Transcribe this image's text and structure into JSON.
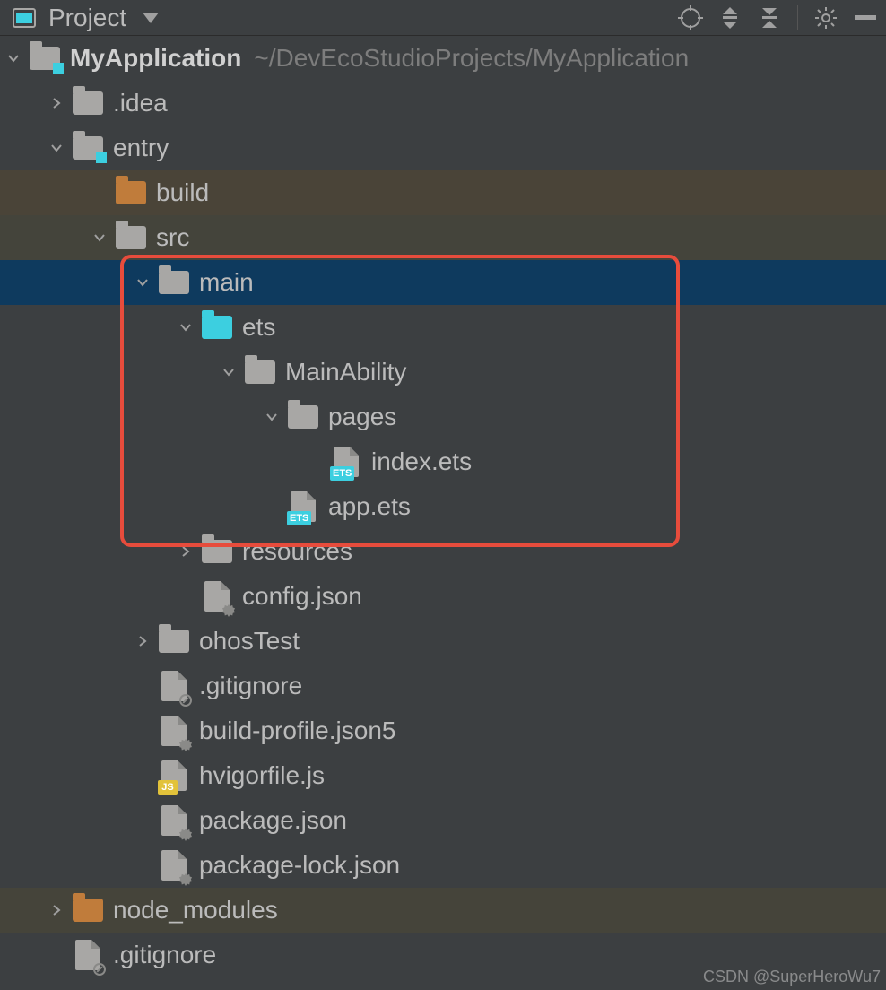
{
  "toolbar": {
    "view_label": "Project"
  },
  "root": {
    "name": "MyApplication",
    "path_hint": "~/DevEcoStudioProjects/MyApplication"
  },
  "nodes": [
    {
      "id": "idea",
      "label": ".idea",
      "indent": 1,
      "arrow": "right",
      "icon": "folder-gray"
    },
    {
      "id": "entry",
      "label": "entry",
      "indent": 1,
      "arrow": "down",
      "icon": "folder-module"
    },
    {
      "id": "build",
      "label": "build",
      "indent": 2,
      "arrow": "none",
      "icon": "folder-orange",
      "shade": "shade1"
    },
    {
      "id": "src",
      "label": "src",
      "indent": 2,
      "arrow": "down",
      "icon": "folder-gray",
      "shade": "shade2"
    },
    {
      "id": "main",
      "label": "main",
      "indent": 3,
      "arrow": "down",
      "icon": "folder-gray",
      "selected": true
    },
    {
      "id": "ets",
      "label": "ets",
      "indent": 4,
      "arrow": "down",
      "icon": "folder-blue"
    },
    {
      "id": "mainability",
      "label": "MainAbility",
      "indent": 5,
      "arrow": "down",
      "icon": "folder-gray"
    },
    {
      "id": "pages",
      "label": "pages",
      "indent": 6,
      "arrow": "down",
      "icon": "folder-gray"
    },
    {
      "id": "index-ets",
      "label": "index.ets",
      "indent": 7,
      "arrow": "none",
      "icon": "file-ets"
    },
    {
      "id": "app-ets",
      "label": "app.ets",
      "indent": 6,
      "arrow": "none",
      "icon": "file-ets"
    },
    {
      "id": "resources",
      "label": "resources",
      "indent": 4,
      "arrow": "right",
      "icon": "folder-gray"
    },
    {
      "id": "config-json",
      "label": "config.json",
      "indent": 4,
      "arrow": "none",
      "icon": "file-gear"
    },
    {
      "id": "ohostest",
      "label": "ohosTest",
      "indent": 3,
      "arrow": "right",
      "icon": "folder-gray"
    },
    {
      "id": "gitignore1",
      "label": ".gitignore",
      "indent": 3,
      "arrow": "none",
      "icon": "file-forbid"
    },
    {
      "id": "buildprofile",
      "label": "build-profile.json5",
      "indent": 3,
      "arrow": "none",
      "icon": "file-gear"
    },
    {
      "id": "hvigor",
      "label": "hvigorfile.js",
      "indent": 3,
      "arrow": "none",
      "icon": "file-js"
    },
    {
      "id": "pkg",
      "label": "package.json",
      "indent": 3,
      "arrow": "none",
      "icon": "file-gear"
    },
    {
      "id": "pkglock",
      "label": "package-lock.json",
      "indent": 3,
      "arrow": "none",
      "icon": "file-gear"
    },
    {
      "id": "nodemods",
      "label": "node_modules",
      "indent": 1,
      "arrow": "right",
      "icon": "folder-orange",
      "shade": "shade3"
    },
    {
      "id": "gitignore2",
      "label": ".gitignore",
      "indent": 1,
      "arrow": "none",
      "icon": "file-forbid"
    }
  ],
  "watermark": "CSDN @SuperHeroWu7"
}
